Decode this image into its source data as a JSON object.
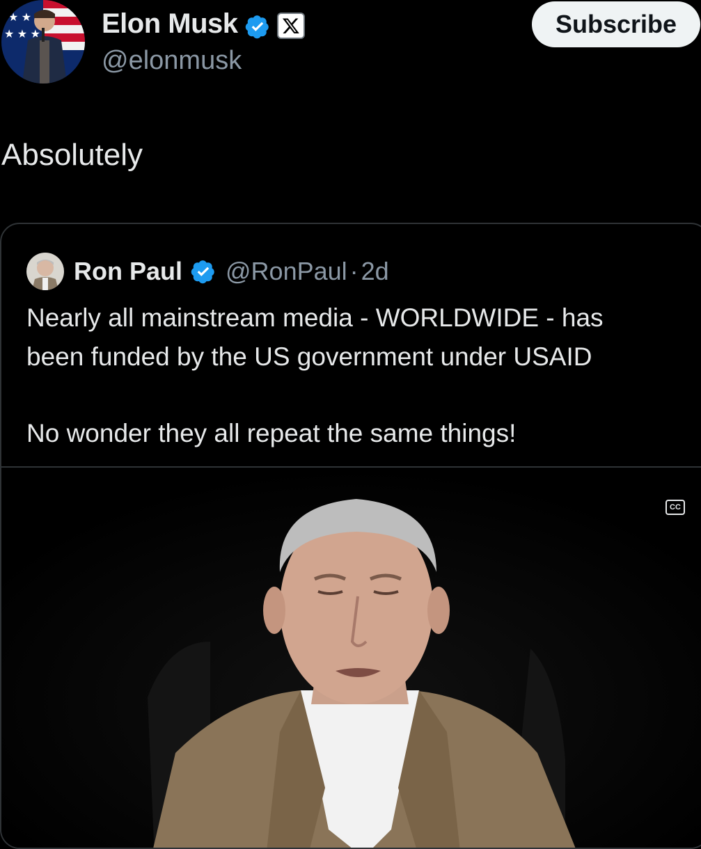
{
  "author": {
    "name": "Elon Musk",
    "handle": "@elonmusk",
    "badge_icon": "x-logo-icon",
    "verified_icon": "verified-badge-icon"
  },
  "subscribe_label": "Subscribe",
  "post": {
    "text": "Absolutely"
  },
  "quote": {
    "name": "Ron Paul",
    "handle": "@RonPaul",
    "separator": "·",
    "time": "2d",
    "lines": [
      "Nearly all mainstream media - WORLDWIDE - has",
      "been funded by the US government under USAID",
      "No wonder they all repeat the same things!"
    ]
  },
  "video": {
    "cc_label": "CC",
    "cc_icon": "closed-captions-icon"
  },
  "colors": {
    "background": "#000000",
    "text": "#e7e9ea",
    "muted": "#8b98a5",
    "verified": "#1d9bf0",
    "border": "#2f3336"
  }
}
